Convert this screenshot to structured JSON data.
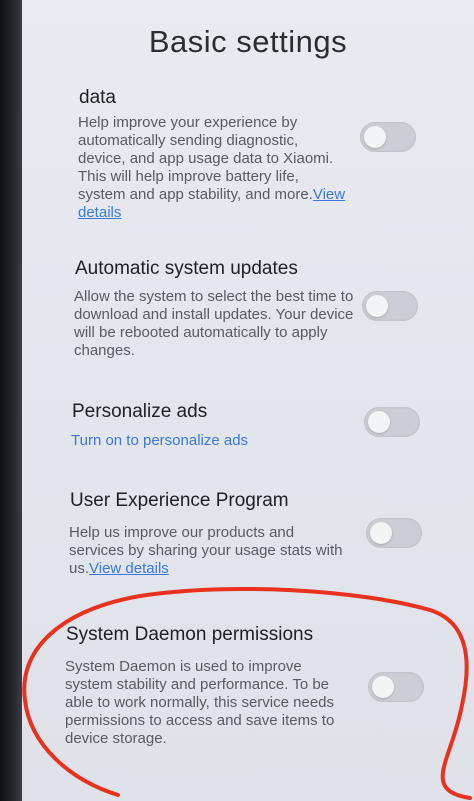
{
  "header": {
    "title": "Basic settings"
  },
  "settings": [
    {
      "title": "data",
      "description": "Help improve your experience by automatically sending diagnostic, device, and app usage data to Xiaomi. This will help improve battery life, system and app stability, and more.",
      "link": "View details",
      "toggle_on": false
    },
    {
      "title": "Automatic system updates",
      "description": "Allow the system to select the best time to download and install updates. Your device will be rebooted automatically to apply changes.",
      "toggle_on": false
    },
    {
      "title": "Personalize ads",
      "link": "Turn on to personalize ads",
      "toggle_on": false
    },
    {
      "title": "User Experience Program",
      "description": "Help us improve our products and services by sharing your usage stats with us.",
      "link": "View details",
      "toggle_on": false
    },
    {
      "title": "System Daemon permissions",
      "description": "System Daemon is used to improve system stability and performance. To be able to work normally, this service needs permissions to access and save items to device storage.",
      "toggle_on": false
    }
  ],
  "colors": {
    "annotation": "#e8321f",
    "link": "#3c79d6",
    "toggle_off": "#cbced4"
  },
  "icons": {
    "annotation_mark": "red-circle-annotation"
  }
}
